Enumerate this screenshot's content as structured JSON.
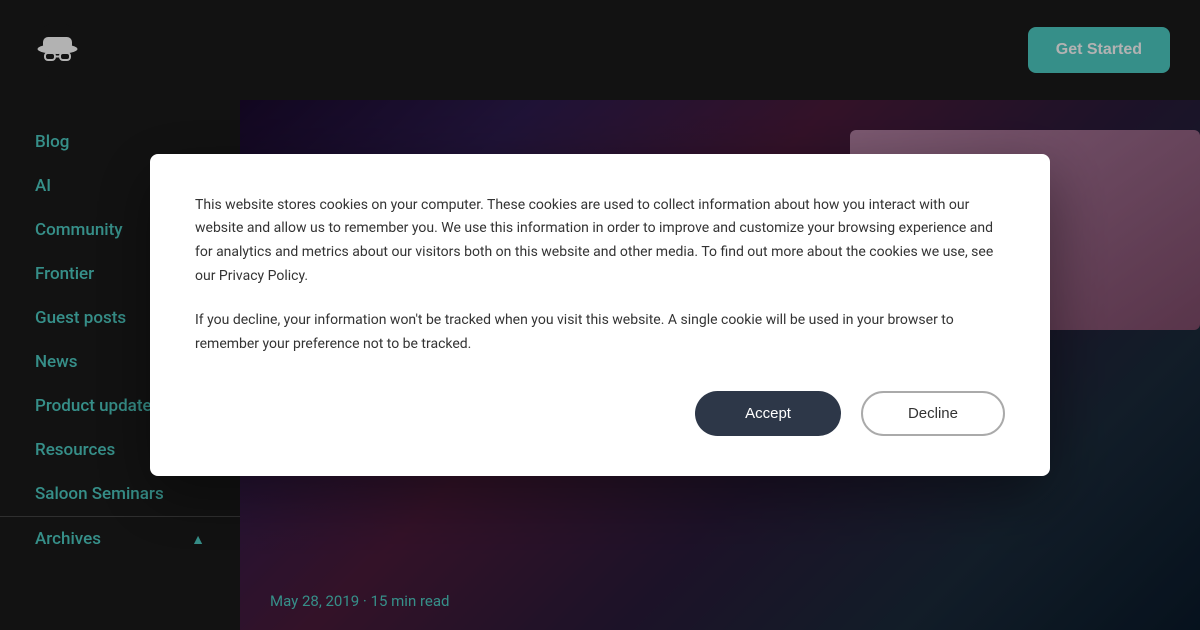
{
  "header": {
    "logo_alt": "Hacker Noon Logo",
    "get_started_label": "Get Started"
  },
  "sidebar": {
    "items": [
      {
        "id": "blog",
        "label": "Blog"
      },
      {
        "id": "ai",
        "label": "AI"
      },
      {
        "id": "community",
        "label": "Community"
      },
      {
        "id": "frontier",
        "label": "Frontier"
      },
      {
        "id": "guest-posts",
        "label": "Guest posts"
      },
      {
        "id": "news",
        "label": "News"
      },
      {
        "id": "product-updates",
        "label": "Product updates"
      },
      {
        "id": "resources",
        "label": "Resources"
      },
      {
        "id": "saloon-seminars",
        "label": "Saloon Seminars"
      }
    ],
    "archives_label": "Archives",
    "archives_chevron": "▲"
  },
  "hero": {
    "date_meta": "May 28, 2019 · 15 min read"
  },
  "cookie_modal": {
    "primary_text": "This website stores cookies on your computer. These cookies are used to collect information about how you interact with our website and allow us to remember you. We use this information in order to improve and customize your browsing experience and for analytics and metrics about our visitors both on this website and other media. To find out more about the cookies we use, see our Privacy Policy.",
    "secondary_text": "If you decline, your information won't be tracked when you visit this website. A single cookie will be used in your browser to remember your preference not to be tracked.",
    "accept_label": "Accept",
    "decline_label": "Decline"
  }
}
